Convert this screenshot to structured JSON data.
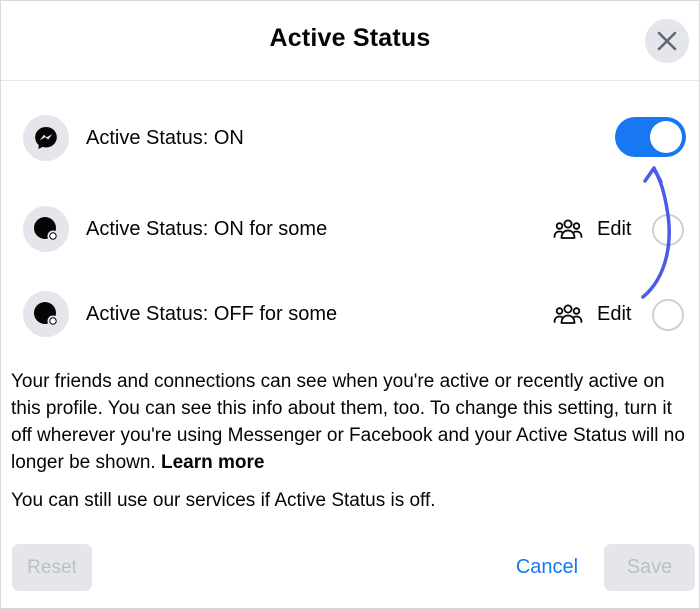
{
  "dialog": {
    "title": "Active Status",
    "close_icon": "close-icon"
  },
  "options": [
    {
      "label": "Active Status: ON",
      "icon": "messenger-icon",
      "control": "toggle",
      "checked": true
    },
    {
      "label": "Active Status: ON for some",
      "icon": "status-dot-icon",
      "edit_label": "Edit",
      "edit_icon": "people-icon",
      "control": "radio",
      "checked": false
    },
    {
      "label": "Active Status: OFF for some",
      "icon": "status-dot-icon",
      "edit_label": "Edit",
      "edit_icon": "people-icon",
      "control": "radio",
      "checked": false
    }
  ],
  "description": {
    "text": "Your friends and connections can see when you're active or recently active on this profile. You can see this info about them, too. To change this setting, turn it off wherever you're using Messenger or Facebook and your Active Status will no longer be shown.",
    "learn_more": "Learn more",
    "note": "You can still use our services if Active Status is off."
  },
  "footer": {
    "reset_label": "Reset",
    "cancel_label": "Cancel",
    "save_label": "Save"
  },
  "colors": {
    "accent": "#1877f2",
    "annotation_arrow": "#4a5be8",
    "disabled_bg": "#e4e6eb",
    "disabled_text": "#bcc0c4"
  }
}
